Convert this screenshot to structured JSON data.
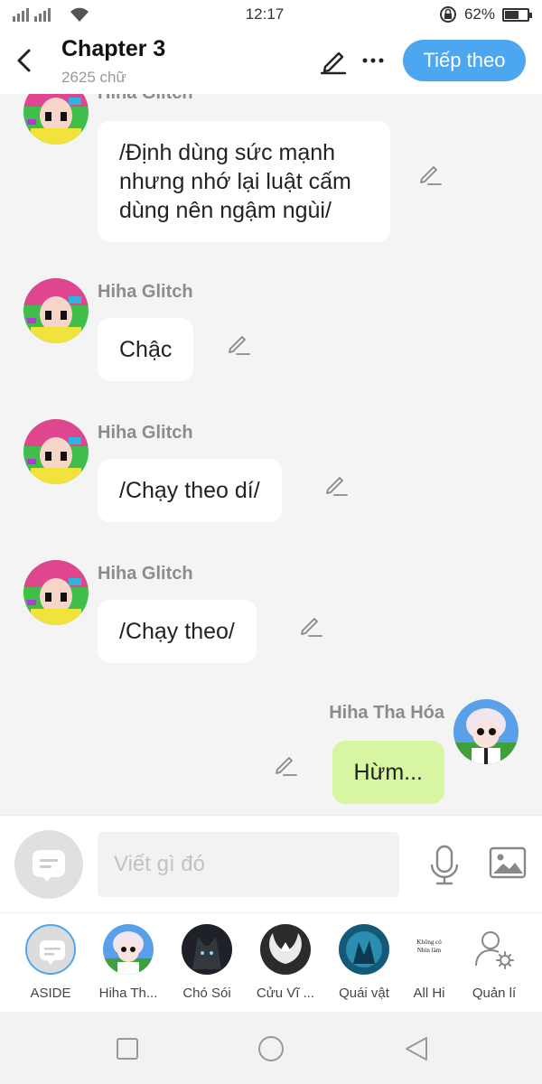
{
  "status": {
    "signal": "  ıl ıl",
    "time": "12:17",
    "battery": "62%",
    "battery_level": 0.62
  },
  "header": {
    "title": "Chapter 3",
    "word_count": "2625 chữ",
    "next_label": "Tiếp theo"
  },
  "messages": [
    {
      "sender": "Hiha Glitch",
      "text": "/Định dùng sức mạnh nhưng nhớ lại luật cấm dùng nên ngậm ngùi/"
    },
    {
      "sender": "Hiha Glitch",
      "text": "Chậc"
    },
    {
      "sender": "Hiha Glitch",
      "text": "/Chạy theo dí/"
    },
    {
      "sender": "Hiha Glitch",
      "text": "/Chạy theo/"
    },
    {
      "sender": "Hiha Tha Hóa",
      "text": "Hừm..."
    }
  ],
  "composer": {
    "placeholder": "Viết gì đó"
  },
  "characters": [
    {
      "label": "ASIDE"
    },
    {
      "label": "Hiha Th..."
    },
    {
      "label": "Chó Sói"
    },
    {
      "label": "Cửu Vĩ ..."
    },
    {
      "label": "Quái vật"
    },
    {
      "label": "All Hi",
      "pic_text": "Không có Nhìn làm"
    },
    {
      "label": "Quản lí"
    }
  ],
  "colors": {
    "accent": "#4da6f0",
    "my_bubble": "#d8f5a2",
    "name_gray": "#8c8c8c"
  }
}
